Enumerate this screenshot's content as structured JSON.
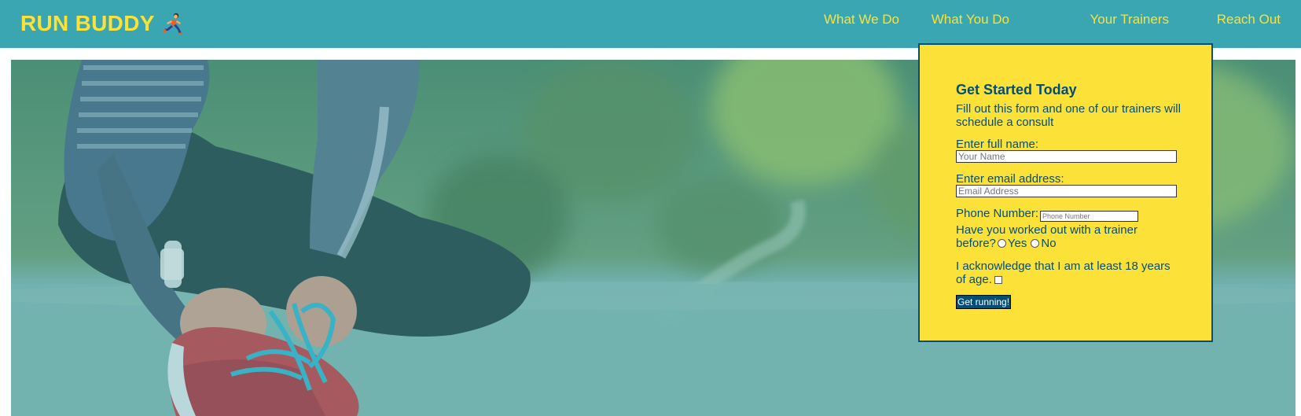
{
  "header": {
    "logo_text": "RUN BUDDY",
    "logo_icon": "runner-emoji-icon",
    "nav": [
      {
        "label": "What We Do"
      },
      {
        "label": "What You Do"
      },
      {
        "label": "Your Trainers"
      },
      {
        "label": "Reach Out"
      }
    ]
  },
  "hero": {
    "image": "person-tying-running-shoe-photo"
  },
  "form": {
    "title": "Get Started Today",
    "subtitle": "Fill out this form and one of our trainers will schedule a consult",
    "name_label": "Enter full name:",
    "name_placeholder": "Your Name",
    "email_label": "Enter email address:",
    "email_placeholder": "Email Address",
    "phone_label": "Phone Number:",
    "phone_placeholder": "Phone Number",
    "trainer_question": "Have you worked out with a trainer before?",
    "trainer_question_line1": "Have you worked out with a trainer",
    "trainer_question_line2": "before?",
    "yes_label": "Yes",
    "no_label": "No",
    "ack_line1": "I acknowledge that I am at least 18 years",
    "ack_line2": "of age.",
    "submit_label": "Get running!"
  },
  "colors": {
    "primary": "#39a6b2",
    "accent": "#fce138",
    "dark": "#024e76"
  }
}
